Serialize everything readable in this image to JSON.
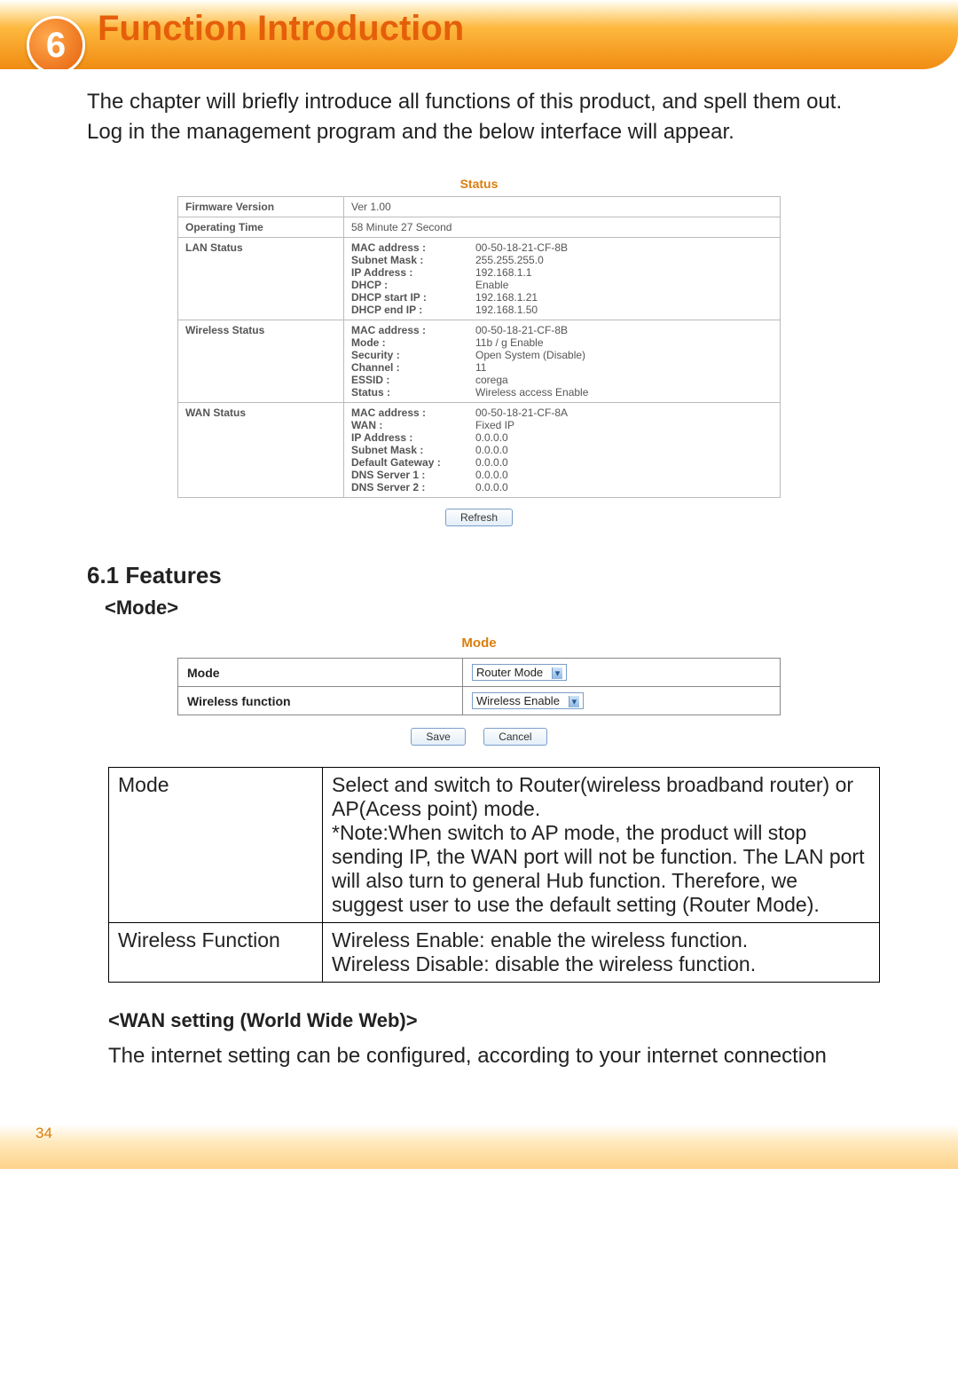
{
  "chapter": {
    "number": "6",
    "title": "Function Introduction"
  },
  "intro": "The chapter will briefly introduce all functions of this product, and spell them out.  Log in the management program and the below interface will appear.",
  "status": {
    "title": "Status",
    "firmware_label": "Firmware Version",
    "firmware_value": "Ver 1.00",
    "optime_label": "Operating Time",
    "optime_value": "58 Minute 27 Second",
    "lan_label": "LAN Status",
    "lan": [
      {
        "k": "MAC address :",
        "v": "00-50-18-21-CF-8B"
      },
      {
        "k": "Subnet Mask :",
        "v": "255.255.255.0"
      },
      {
        "k": "IP Address :",
        "v": "192.168.1.1"
      },
      {
        "k": "DHCP :",
        "v": "Enable"
      },
      {
        "k": "DHCP start IP :",
        "v": "192.168.1.21"
      },
      {
        "k": "DHCP end IP :",
        "v": "192.168.1.50"
      }
    ],
    "wireless_label": "Wireless Status",
    "wireless": [
      {
        "k": "MAC address :",
        "v": "00-50-18-21-CF-8B"
      },
      {
        "k": "Mode :",
        "v": "11b / g Enable"
      },
      {
        "k": "Security :",
        "v": "Open System (Disable)"
      },
      {
        "k": "Channel :",
        "v": "11"
      },
      {
        "k": "ESSID :",
        "v": "corega"
      },
      {
        "k": "Status :",
        "v": "Wireless access Enable"
      }
    ],
    "wan_label": "WAN Status",
    "wan": [
      {
        "k": "MAC address :",
        "v": "00-50-18-21-CF-8A"
      },
      {
        "k": "WAN :",
        "v": "Fixed IP"
      },
      {
        "k": "IP Address :",
        "v": "0.0.0.0"
      },
      {
        "k": "Subnet Mask :",
        "v": "0.0.0.0"
      },
      {
        "k": "Default Gateway :",
        "v": "0.0.0.0"
      },
      {
        "k": "DNS Server 1 :",
        "v": "0.0.0.0"
      },
      {
        "k": "DNS Server 2 :",
        "v": "0.0.0.0"
      }
    ],
    "refresh": "Refresh"
  },
  "section": {
    "features_heading": "6.1 Features",
    "mode_heading": "<Mode>",
    "wan_heading": "<WAN setting (World Wide Web)>",
    "wan_body": "The internet setting can be configured, according to your internet connection"
  },
  "mode_panel": {
    "title": "Mode",
    "row1_label": "Mode",
    "row1_value": "Router Mode",
    "row2_label": "Wireless function",
    "row2_value": "Wireless Enable",
    "save": "Save",
    "cancel": "Cancel"
  },
  "expl": {
    "r1_label": "Mode",
    "r1_text": "Select and switch to Router(wireless broadband router) or AP(Acess point) mode.\n*Note:When switch to AP mode, the product will stop sending IP, the WAN port will not be function. The LAN port will also turn to general Hub function. Therefore, we suggest user to use the default setting (Router Mode).",
    "r2_label": "Wireless Function",
    "r2_text": "Wireless Enable: enable the wireless function.\nWireless Disable: disable the wireless function."
  },
  "page_number": "34"
}
